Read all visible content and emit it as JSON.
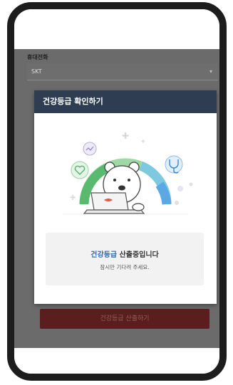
{
  "form": {
    "carrier_label": "휴대전화",
    "carrier_value": "SKT",
    "submit_label": "건강등급 산출하기"
  },
  "modal": {
    "title": "건강등급 확인하기",
    "status_highlight": "건강등급",
    "status_rest": " 산출중입니다",
    "status_sub": "잠시만 기다려 주세요."
  },
  "colors": {
    "header_bg": "#2e3d52",
    "highlight": "#2a6db5",
    "overlay": "#6b6b6b",
    "submit_bg": "#5a1e1e"
  },
  "icons": [
    "chevron-down-icon",
    "heart-icon",
    "stethoscope-icon",
    "bear-mascot",
    "laptop-icon",
    "health-gauge"
  ]
}
